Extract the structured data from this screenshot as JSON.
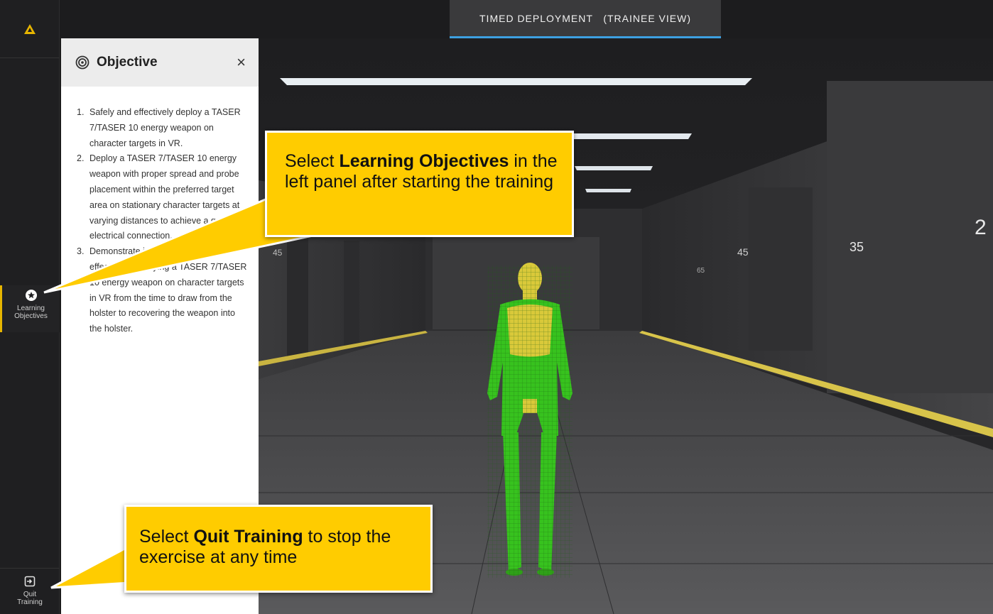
{
  "header": {
    "title": "TIMED DEPLOYMENT   (TRAINEE VIEW)"
  },
  "rail": {
    "learning_objectives": {
      "line1": "Learning",
      "line2": "Objectives"
    },
    "quit_training": {
      "line1": "Quit",
      "line2": "Training"
    }
  },
  "panel": {
    "title": "Objective",
    "close_label": "×",
    "objectives": [
      {
        "num": "1.",
        "text": "Safely and effectively deploy a TASER 7/TASER 10 energy weapon on character targets in VR."
      },
      {
        "num": "2.",
        "text": "Deploy a TASER 7/TASER 10 energy weapon with proper spread and probe placement within the preferred target area on stationary character targets at varying distances to achieve a good electrical connection."
      },
      {
        "num": "3.",
        "text": "Demonstrate increased efficiency in effectively deploying a TASER 7/TASER 10 energy weapon on character targets in VR from the time to draw from the holster to recovering the weapon into the holster."
      }
    ]
  },
  "scene": {
    "distance_markers": [
      "45",
      "35",
      "2",
      "45",
      "65",
      "45"
    ]
  },
  "callouts": {
    "learning": {
      "pre": "Select ",
      "bold": "Learning Objectives",
      "post": " in the left panel after starting the training"
    },
    "quit": {
      "pre": "Select ",
      "bold": "Quit Training",
      "post": " to stop the exercise at any time"
    }
  },
  "colors": {
    "accent": "#ffcc00",
    "tab_underline": "#3da0e0",
    "target_green": "#37c21e",
    "target_zone": "#d9c93a"
  }
}
